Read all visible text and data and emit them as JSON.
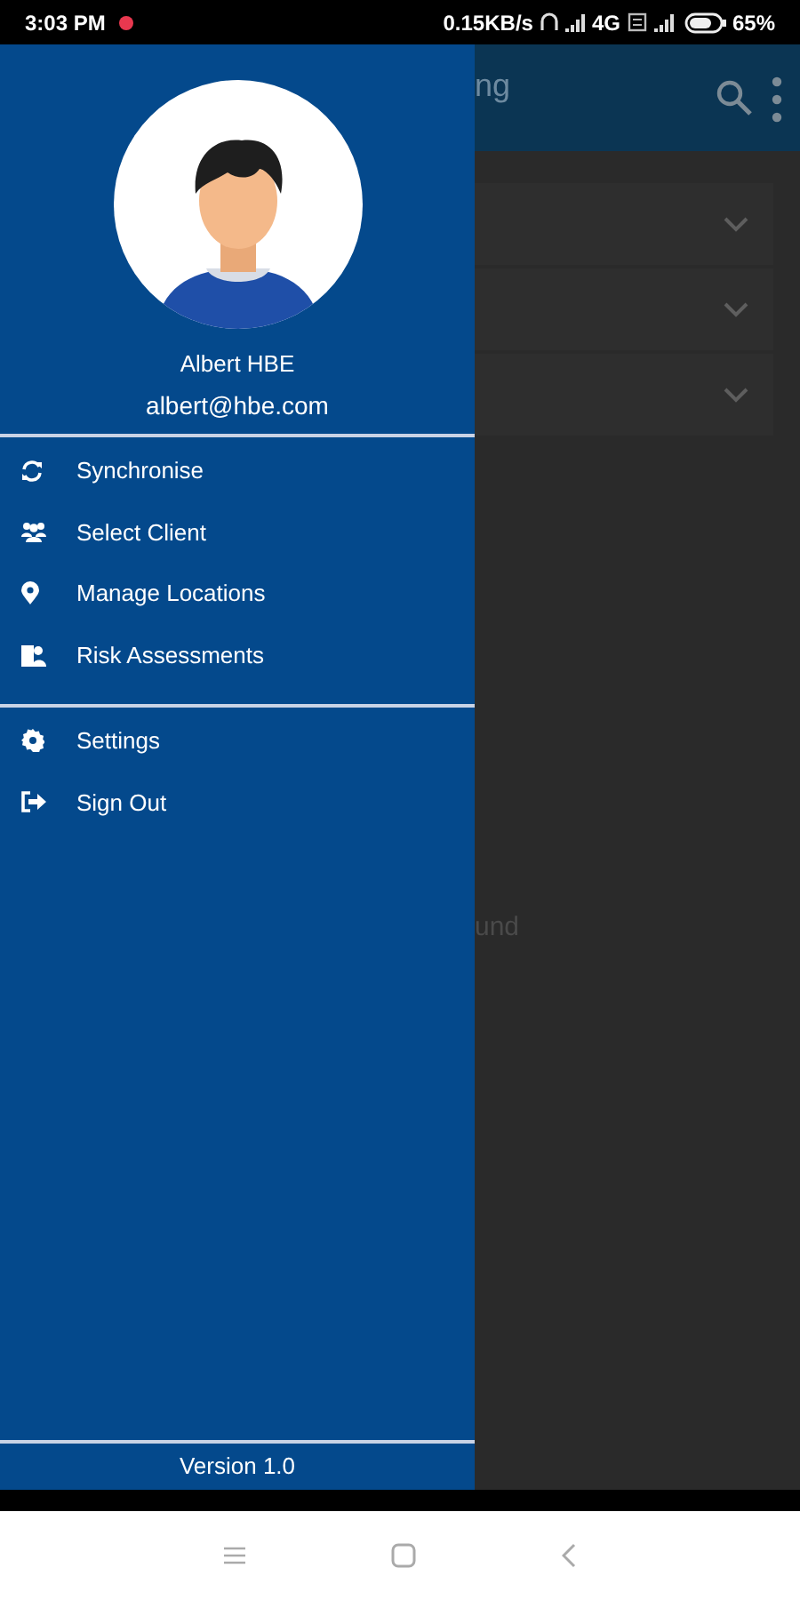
{
  "status_bar": {
    "time": "3:03 PM",
    "speed": "0.15KB/s",
    "network": "4G",
    "battery": "65%"
  },
  "app_bar": {
    "title": "ng"
  },
  "cards": [
    {
      "expanded": false
    },
    {
      "expanded": false
    },
    {
      "expanded": false
    }
  ],
  "empty_message": "und",
  "drawer": {
    "user": {
      "name": "Albert HBE",
      "email": "albert@hbe.com"
    },
    "sections": [
      [
        {
          "kind": "sync",
          "label": "Synchronise"
        },
        {
          "kind": "people",
          "label": "Select Client"
        },
        {
          "kind": "pin",
          "label": "Manage Locations"
        },
        {
          "kind": "risk",
          "label": "Risk Assessments"
        }
      ],
      [
        {
          "kind": "gear",
          "label": "Settings"
        },
        {
          "kind": "signout",
          "label": "Sign Out"
        }
      ]
    ],
    "version": "Version 1.0"
  }
}
